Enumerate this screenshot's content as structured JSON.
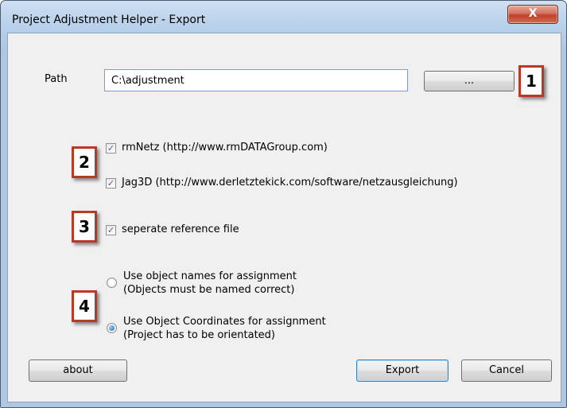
{
  "window": {
    "title": "Project Adjustment Helper - Export",
    "close_glyph": "X"
  },
  "path": {
    "label": "Path",
    "value": "C:\\adjustment",
    "browse_label": "..."
  },
  "checkboxes": [
    {
      "label": "rmNetz (http://www.rmDATAGroup.com)",
      "checked": true
    },
    {
      "label": "Jag3D (http://www.derletztekick.com/software/netzausgleichung)",
      "checked": true
    },
    {
      "label": "seperate reference file",
      "checked": true
    }
  ],
  "radios": [
    {
      "line1": "Use object names for assignment",
      "line2": "(Objects must be named correct)",
      "selected": false
    },
    {
      "line1": "Use Object Coordinates for assignment",
      "line2": "(Project has to be orientated)",
      "selected": true
    }
  ],
  "buttons": {
    "about": "about",
    "export": "Export",
    "cancel": "Cancel"
  },
  "annotations": [
    "1",
    "2",
    "3",
    "4"
  ],
  "colors": {
    "badge_border": "#b83a24",
    "title_bar": "#b9d1ea",
    "dialog_bg": "#f0f0f0"
  }
}
